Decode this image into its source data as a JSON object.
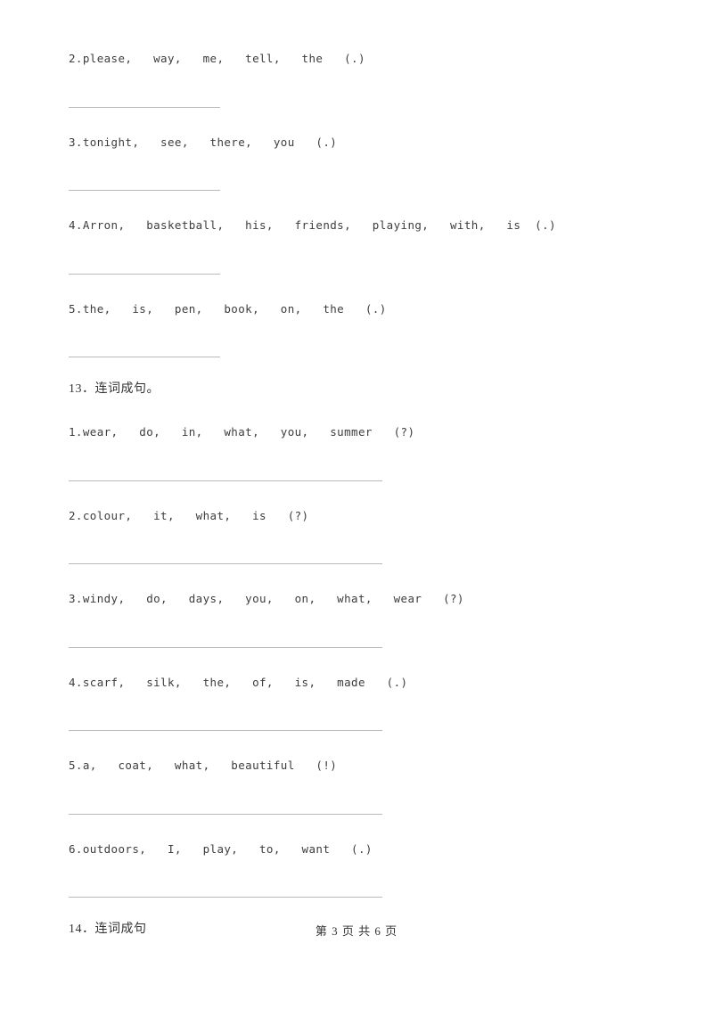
{
  "document": {
    "sections": [
      {
        "id": "section-12-continued",
        "heading": null,
        "rule_width": "short",
        "items": [
          {
            "number": "2.",
            "text": "please,   way,   me,   tell,   the   (.)"
          },
          {
            "number": "3.",
            "text": "tonight,   see,   there,   you   (.)"
          },
          {
            "number": "4.",
            "text": "Arron,   basketball,   his,   friends,   playing,   with,   is  (.)"
          },
          {
            "number": "5.",
            "text": "the,   is,   pen,   book,   on,   the   (.)"
          }
        ]
      },
      {
        "id": "section-13",
        "heading": "13．连词成句。",
        "rule_width": "long",
        "items": [
          {
            "number": "1.",
            "text": "wear,   do,   in,   what,   you,   summer   (?)"
          },
          {
            "number": "2.",
            "text": "colour,   it,   what,   is   (?)"
          },
          {
            "number": "3.",
            "text": "windy,   do,   days,   you,   on,   what,   wear   (?)"
          },
          {
            "number": "4.",
            "text": "scarf,   silk,   the,   of,   is,   made   (.)"
          },
          {
            "number": "5.",
            "text": "a,   coat,   what,   beautiful   (!)"
          },
          {
            "number": "6.",
            "text": "outdoors,   I,   play,   to,   want   (.)"
          }
        ]
      },
      {
        "id": "section-14",
        "heading": "14．连词成句",
        "rule_width": "long",
        "items": []
      }
    ],
    "footer": {
      "text": "第 3 页 共 6 页"
    }
  }
}
